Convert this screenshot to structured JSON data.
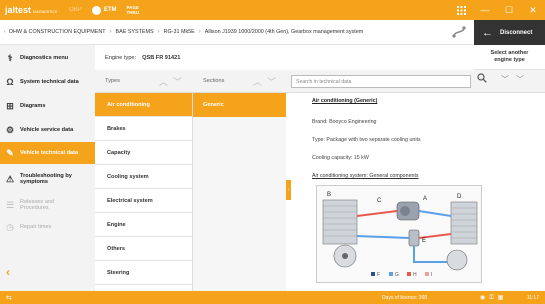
{
  "app": {
    "logo": "jaltest",
    "logo_sub": "DIAGNOSTICS",
    "tabs": [
      {
        "label": "OBP",
        "active": false
      },
      {
        "label": "ETM",
        "active": true
      },
      {
        "label": "PAGE THRU",
        "active": true
      }
    ]
  },
  "window_controls": {
    "grid_icon": "grid-icon",
    "minimize": "—",
    "maximize": "☐",
    "close": "✕"
  },
  "breadcrumb": {
    "items": [
      "OHW & CONSTRUCTION EQUIPMENT",
      "BAE SYSTEMS",
      "RG-31 Mk5E",
      "Allison J1939 1000/2000 (4th Gen), Gearbox management system"
    ]
  },
  "disconnect": {
    "label": "Disconnect"
  },
  "select_engine": {
    "label": "Select another engine type"
  },
  "engine": {
    "label": "Engine type:",
    "value": "QSB FR 91421"
  },
  "sidebar": {
    "items": [
      {
        "label": "Diagnostics menu",
        "icon": "stethoscope-icon",
        "state": "normal"
      },
      {
        "label": "System technical data",
        "icon": "system-data-icon",
        "state": "normal"
      },
      {
        "label": "Diagrams",
        "icon": "diagram-icon",
        "state": "normal"
      },
      {
        "label": "Vehicle service data",
        "icon": "wrench-icon",
        "state": "normal"
      },
      {
        "label": "Vehicle technical data",
        "icon": "tools-icon",
        "state": "active"
      },
      {
        "label": "Troubleshooting by symptoms",
        "icon": "troubleshoot-icon",
        "state": "normal"
      },
      {
        "label": "Releases and Procedures",
        "icon": "procedures-icon",
        "state": "disabled"
      },
      {
        "label": "Repair times",
        "icon": "clock-icon",
        "state": "disabled"
      }
    ]
  },
  "columns": {
    "types": "Types",
    "sections": "Sections"
  },
  "search": {
    "placeholder": "Search in technical data"
  },
  "types": [
    {
      "label": "Air conditioning",
      "active": true
    },
    {
      "label": "Brakes",
      "active": false
    },
    {
      "label": "Capacity",
      "active": false
    },
    {
      "label": "Cooling system",
      "active": false
    },
    {
      "label": "Electrical system",
      "active": false
    },
    {
      "label": "Engine",
      "active": false
    },
    {
      "label": "Others",
      "active": false
    },
    {
      "label": "Steering",
      "active": false
    }
  ],
  "sections": [
    {
      "label": "Generic",
      "active": true
    }
  ],
  "content": {
    "title": "Air conditioning (Generic)",
    "brand": "Brand: Booyco Engineering",
    "type": "Type: Package with two separate cooling units",
    "capacity": "Cooling capacity: 15 kW",
    "system_link": "Air conditioning system: General components",
    "diagram_labels": [
      "A",
      "B",
      "C",
      "D",
      "E"
    ],
    "legend": [
      "F",
      "G",
      "H",
      "I"
    ]
  },
  "status": {
    "licence": "Days of licence: 368",
    "time": "11:17"
  },
  "colors": {
    "accent": "#f5a31a",
    "dark": "#333333"
  }
}
